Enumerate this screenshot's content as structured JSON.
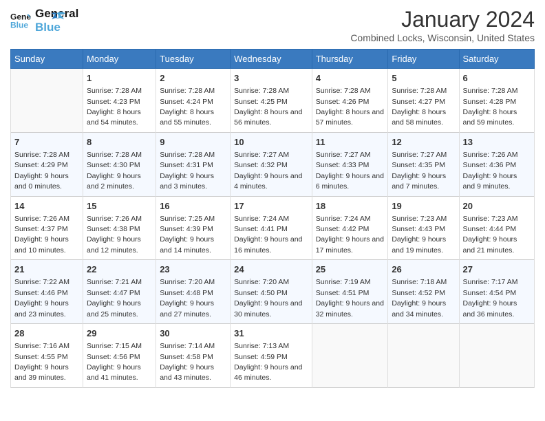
{
  "logo": {
    "line1": "General",
    "line2": "Blue"
  },
  "title": "January 2024",
  "subtitle": "Combined Locks, Wisconsin, United States",
  "days_of_week": [
    "Sunday",
    "Monday",
    "Tuesday",
    "Wednesday",
    "Thursday",
    "Friday",
    "Saturday"
  ],
  "weeks": [
    [
      {
        "day": "",
        "sunrise": "",
        "sunset": "",
        "daylight": ""
      },
      {
        "day": "1",
        "sunrise": "Sunrise: 7:28 AM",
        "sunset": "Sunset: 4:23 PM",
        "daylight": "Daylight: 8 hours and 54 minutes."
      },
      {
        "day": "2",
        "sunrise": "Sunrise: 7:28 AM",
        "sunset": "Sunset: 4:24 PM",
        "daylight": "Daylight: 8 hours and 55 minutes."
      },
      {
        "day": "3",
        "sunrise": "Sunrise: 7:28 AM",
        "sunset": "Sunset: 4:25 PM",
        "daylight": "Daylight: 8 hours and 56 minutes."
      },
      {
        "day": "4",
        "sunrise": "Sunrise: 7:28 AM",
        "sunset": "Sunset: 4:26 PM",
        "daylight": "Daylight: 8 hours and 57 minutes."
      },
      {
        "day": "5",
        "sunrise": "Sunrise: 7:28 AM",
        "sunset": "Sunset: 4:27 PM",
        "daylight": "Daylight: 8 hours and 58 minutes."
      },
      {
        "day": "6",
        "sunrise": "Sunrise: 7:28 AM",
        "sunset": "Sunset: 4:28 PM",
        "daylight": "Daylight: 8 hours and 59 minutes."
      }
    ],
    [
      {
        "day": "7",
        "sunrise": "Sunrise: 7:28 AM",
        "sunset": "Sunset: 4:29 PM",
        "daylight": "Daylight: 9 hours and 0 minutes."
      },
      {
        "day": "8",
        "sunrise": "Sunrise: 7:28 AM",
        "sunset": "Sunset: 4:30 PM",
        "daylight": "Daylight: 9 hours and 2 minutes."
      },
      {
        "day": "9",
        "sunrise": "Sunrise: 7:28 AM",
        "sunset": "Sunset: 4:31 PM",
        "daylight": "Daylight: 9 hours and 3 minutes."
      },
      {
        "day": "10",
        "sunrise": "Sunrise: 7:27 AM",
        "sunset": "Sunset: 4:32 PM",
        "daylight": "Daylight: 9 hours and 4 minutes."
      },
      {
        "day": "11",
        "sunrise": "Sunrise: 7:27 AM",
        "sunset": "Sunset: 4:33 PM",
        "daylight": "Daylight: 9 hours and 6 minutes."
      },
      {
        "day": "12",
        "sunrise": "Sunrise: 7:27 AM",
        "sunset": "Sunset: 4:35 PM",
        "daylight": "Daylight: 9 hours and 7 minutes."
      },
      {
        "day": "13",
        "sunrise": "Sunrise: 7:26 AM",
        "sunset": "Sunset: 4:36 PM",
        "daylight": "Daylight: 9 hours and 9 minutes."
      }
    ],
    [
      {
        "day": "14",
        "sunrise": "Sunrise: 7:26 AM",
        "sunset": "Sunset: 4:37 PM",
        "daylight": "Daylight: 9 hours and 10 minutes."
      },
      {
        "day": "15",
        "sunrise": "Sunrise: 7:26 AM",
        "sunset": "Sunset: 4:38 PM",
        "daylight": "Daylight: 9 hours and 12 minutes."
      },
      {
        "day": "16",
        "sunrise": "Sunrise: 7:25 AM",
        "sunset": "Sunset: 4:39 PM",
        "daylight": "Daylight: 9 hours and 14 minutes."
      },
      {
        "day": "17",
        "sunrise": "Sunrise: 7:24 AM",
        "sunset": "Sunset: 4:41 PM",
        "daylight": "Daylight: 9 hours and 16 minutes."
      },
      {
        "day": "18",
        "sunrise": "Sunrise: 7:24 AM",
        "sunset": "Sunset: 4:42 PM",
        "daylight": "Daylight: 9 hours and 17 minutes."
      },
      {
        "day": "19",
        "sunrise": "Sunrise: 7:23 AM",
        "sunset": "Sunset: 4:43 PM",
        "daylight": "Daylight: 9 hours and 19 minutes."
      },
      {
        "day": "20",
        "sunrise": "Sunrise: 7:23 AM",
        "sunset": "Sunset: 4:44 PM",
        "daylight": "Daylight: 9 hours and 21 minutes."
      }
    ],
    [
      {
        "day": "21",
        "sunrise": "Sunrise: 7:22 AM",
        "sunset": "Sunset: 4:46 PM",
        "daylight": "Daylight: 9 hours and 23 minutes."
      },
      {
        "day": "22",
        "sunrise": "Sunrise: 7:21 AM",
        "sunset": "Sunset: 4:47 PM",
        "daylight": "Daylight: 9 hours and 25 minutes."
      },
      {
        "day": "23",
        "sunrise": "Sunrise: 7:20 AM",
        "sunset": "Sunset: 4:48 PM",
        "daylight": "Daylight: 9 hours and 27 minutes."
      },
      {
        "day": "24",
        "sunrise": "Sunrise: 7:20 AM",
        "sunset": "Sunset: 4:50 PM",
        "daylight": "Daylight: 9 hours and 30 minutes."
      },
      {
        "day": "25",
        "sunrise": "Sunrise: 7:19 AM",
        "sunset": "Sunset: 4:51 PM",
        "daylight": "Daylight: 9 hours and 32 minutes."
      },
      {
        "day": "26",
        "sunrise": "Sunrise: 7:18 AM",
        "sunset": "Sunset: 4:52 PM",
        "daylight": "Daylight: 9 hours and 34 minutes."
      },
      {
        "day": "27",
        "sunrise": "Sunrise: 7:17 AM",
        "sunset": "Sunset: 4:54 PM",
        "daylight": "Daylight: 9 hours and 36 minutes."
      }
    ],
    [
      {
        "day": "28",
        "sunrise": "Sunrise: 7:16 AM",
        "sunset": "Sunset: 4:55 PM",
        "daylight": "Daylight: 9 hours and 39 minutes."
      },
      {
        "day": "29",
        "sunrise": "Sunrise: 7:15 AM",
        "sunset": "Sunset: 4:56 PM",
        "daylight": "Daylight: 9 hours and 41 minutes."
      },
      {
        "day": "30",
        "sunrise": "Sunrise: 7:14 AM",
        "sunset": "Sunset: 4:58 PM",
        "daylight": "Daylight: 9 hours and 43 minutes."
      },
      {
        "day": "31",
        "sunrise": "Sunrise: 7:13 AM",
        "sunset": "Sunset: 4:59 PM",
        "daylight": "Daylight: 9 hours and 46 minutes."
      },
      {
        "day": "",
        "sunrise": "",
        "sunset": "",
        "daylight": ""
      },
      {
        "day": "",
        "sunrise": "",
        "sunset": "",
        "daylight": ""
      },
      {
        "day": "",
        "sunrise": "",
        "sunset": "",
        "daylight": ""
      }
    ]
  ]
}
